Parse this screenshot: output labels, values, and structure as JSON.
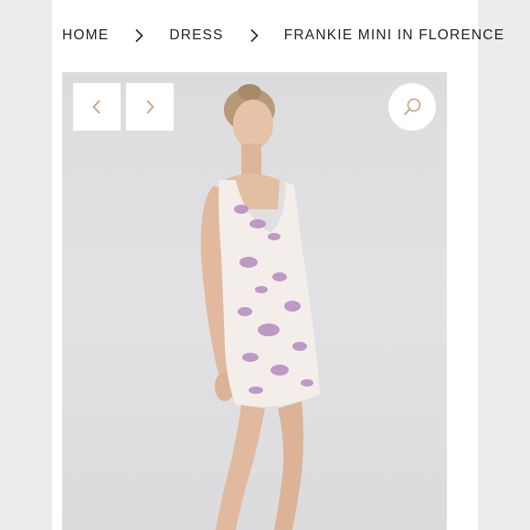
{
  "breadcrumb": {
    "items": [
      "HOME",
      "DRESS",
      "FRANKIE MINI IN FLORENCE"
    ]
  },
  "gallery": {
    "image_description_icon": "product-photo",
    "prev_icon": "chevron-left-icon",
    "next_icon": "chevron-right-icon",
    "zoom_icon": "search-icon"
  },
  "colors": {
    "accent": "#c9a27e",
    "text": "#222222",
    "dress_print": "#b58bbf"
  }
}
